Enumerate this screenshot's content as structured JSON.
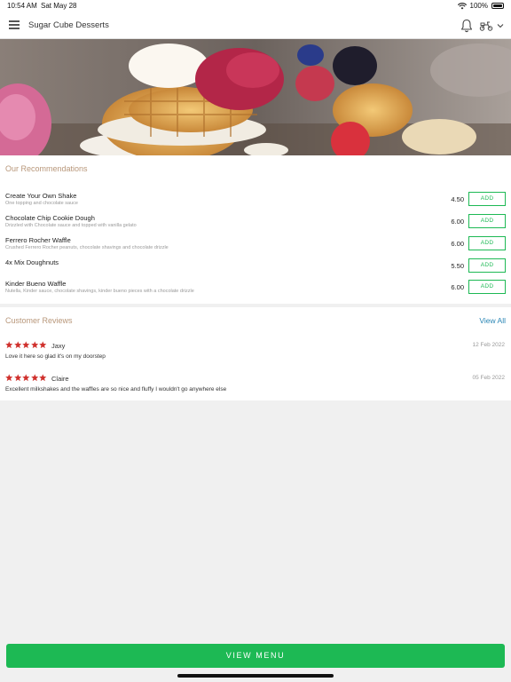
{
  "status_bar": {
    "time": "10:54 AM",
    "date": "Sat May 28",
    "battery": "100%"
  },
  "nav": {
    "title": "Sugar Cube Desserts",
    "menu_icon": "hamburger-menu-icon",
    "bell_icon": "bell-icon",
    "delivery_icon": "scooter-icon"
  },
  "hero": {
    "image": "waffle-dessert-photo"
  },
  "recommendations": {
    "title": "Our Recommendations",
    "add_label": "ADD",
    "items": [
      {
        "name": "Create Your Own Shake",
        "description": "One topping and chocolate sauce",
        "price": "4.50"
      },
      {
        "name": "Chocolate Chip Cookie Dough",
        "description": "Drizzled with Chocolate sauce and topped with vanilla gelato",
        "price": "6.00"
      },
      {
        "name": "Ferrero Rocher Waffle",
        "description": "Crushed Ferrero Rocher peanuts, chocolate shavings and chocolate drizzle",
        "price": "6.00"
      },
      {
        "name": "4x Mix Doughnuts",
        "description": "",
        "price": "5.50"
      },
      {
        "name": "Kinder Bueno Waffle",
        "description": "Nutella, Kinder sauce, chocolate shavings, kinder bueno pieces with a chocolate drizzle",
        "price": "6.00"
      }
    ]
  },
  "reviews": {
    "title": "Customer Reviews",
    "view_all": "View All",
    "items": [
      {
        "name": "Jaxy",
        "date": "12 Feb 2022",
        "text": "Love it here so glad it's on my doorstep",
        "rating": 5
      },
      {
        "name": "Claire",
        "date": "05 Feb 2022",
        "text": "Excellent milkshakes and the waffles are so nice and fluffy I wouldn't go anywhere else",
        "rating": 5
      }
    ]
  },
  "footer": {
    "view_menu": "VIEW MENU"
  },
  "colors": {
    "accent_green": "#1db954",
    "section_title": "#b8977a",
    "link_blue": "#2a86b5",
    "star_red": "#d0312d"
  }
}
